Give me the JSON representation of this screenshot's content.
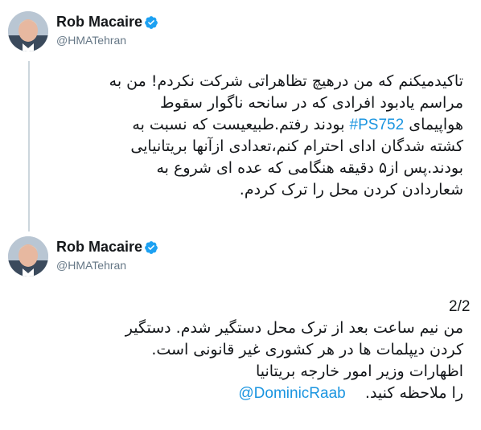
{
  "tweets": [
    {
      "author": "Rob Macaire",
      "handle": "@HMATehran",
      "lines": [
        "تاکیدمیکنم که من درهیچ تظاهراتی شرکت نکردم! من به",
        "مراسم یادبود افرادی که در سانحه ناگوار سقوط",
        "کشته شدگان ادای احترام کنم،تعدادی ازآنها بریتانیایی",
        "بودند.پس از۵ دقیقه هنگامی که عده ای شروع به",
        "شعاردادن کردن محل را ترک کردم."
      ],
      "line3_prefix": "هواپیمای",
      "hashtag": "#PS752",
      "line3_suffix": "بودند رفتم.طبیعیست که نسبت به"
    },
    {
      "author": "Rob Macaire",
      "handle": "@HMATehran",
      "counter": "2/2",
      "lines": [
        "من نیم ساعت بعد از ترک محل دستگیر شدم. دستگیر",
        "کردن دیپلمات ها در هر کشوری غیر قانونی است.",
        "اظهارات وزیر امور خارجه بریتانیا"
      ],
      "mention": "@DominicRaab",
      "last_suffix": "را ملاحظه کنید."
    }
  ],
  "icons": {
    "verified": "verified-badge-icon",
    "verified_color": "#1da1f2"
  },
  "colors": {
    "link": "#1b95e0",
    "handle": "#657786",
    "thread_line": "#ccd6dd"
  }
}
